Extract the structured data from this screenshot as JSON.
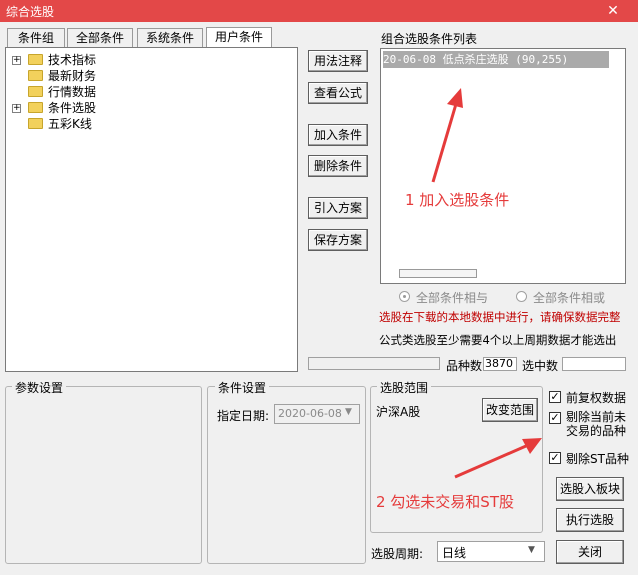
{
  "window": {
    "title": "综合选股",
    "close_glyph": "✕"
  },
  "tabs": [
    "条件组",
    "全部条件",
    "系统条件",
    "用户条件"
  ],
  "tree": [
    {
      "label": "技术指标",
      "expandable": true
    },
    {
      "label": "最新财务",
      "expandable": false
    },
    {
      "label": "行情数据",
      "expandable": false
    },
    {
      "label": "条件选股",
      "expandable": true
    },
    {
      "label": "五彩K线",
      "expandable": false
    }
  ],
  "side_buttons": [
    "用法注释",
    "查看公式",
    "加入条件",
    "删除条件",
    "引入方案",
    "保存方案"
  ],
  "combo": {
    "title": "组合选股条件列表",
    "items": [
      "20-06-08 低点杀庄选股 (90,255)"
    ]
  },
  "radios": {
    "all_and": "全部条件相与",
    "all_or": "全部条件相或"
  },
  "notes": {
    "warning": "选股在下载的本地数据中进行，请确保数据完整",
    "formula": "公式类选股至少需要4个以上周期数据才能选出"
  },
  "stats": {
    "count_label": "品种数",
    "count_value": "3870",
    "selected_label": "选中数",
    "selected_value": ""
  },
  "params": {
    "title": "参数设置"
  },
  "conditions": {
    "title": "条件设置",
    "date_label": "指定日期:",
    "date_value": "2020-06-08"
  },
  "scope": {
    "title": "选股范围",
    "value": "沪深A股",
    "change_button": "改变范围"
  },
  "checkboxes": [
    {
      "label": "前复权数据",
      "checked": true
    },
    {
      "label": "剔除当前未\n交易的品种",
      "checked": true
    },
    {
      "label": "剔除ST品种",
      "checked": true
    }
  ],
  "actions": {
    "to_block": "选股入板块",
    "run": "执行选股",
    "close": "关闭"
  },
  "period": {
    "label": "选股周期:",
    "value": "日线"
  },
  "annotations": {
    "a1": "1 加入选股条件",
    "a2": "2 勾选未交易和ST股"
  },
  "colors": {
    "titlebar": "#e34848",
    "annotation": "#e53b3b",
    "warning_text": "#c00000"
  }
}
